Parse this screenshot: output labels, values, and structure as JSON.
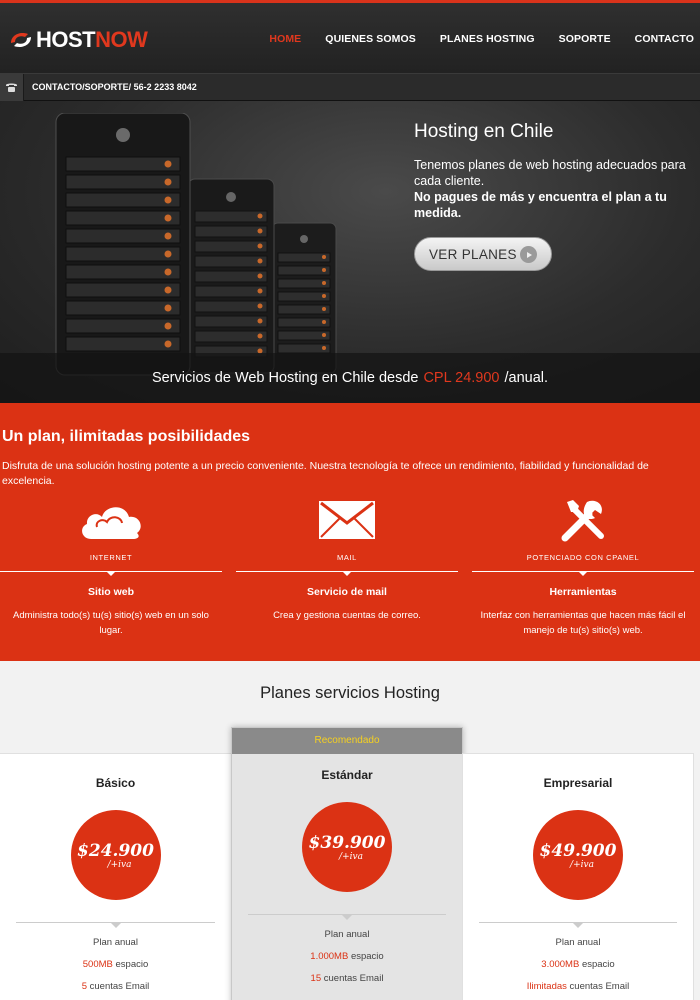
{
  "brand": {
    "host": "HOST",
    "now": "NOW"
  },
  "nav": {
    "items": [
      {
        "label": "HOME",
        "active": true
      },
      {
        "label": "QUIENES SOMOS",
        "active": false
      },
      {
        "label": "PLANES HOSTING",
        "active": false
      },
      {
        "label": "SOPORTE",
        "active": false
      },
      {
        "label": "CONTACTO",
        "active": false
      }
    ]
  },
  "contact_bar": {
    "text": "CONTACTO/SOPORTE/ 56-2 2233 8042",
    "icon": "phone-icon"
  },
  "hero": {
    "title": "Hosting en Chile",
    "desc": "Tenemos planes de web hosting adecuados para cada cliente.",
    "desc_bold": "No pagues de más y encuentra el plan a tu medida.",
    "button": "VER PLANES",
    "band_before": "Servicios de Web Hosting en Chile desde",
    "band_price": "CPL 24.900",
    "band_after": "/anual."
  },
  "features_section": {
    "title": "Un plan, ilimitadas posibilidades",
    "desc": "Disfruta de una solución hosting potente a un precio conveniente. Nuestra tecnología te ofrece un rendimiento, fiabilidad y funcionalidad de excelencia.",
    "items": [
      {
        "caption": "INTERNET",
        "title": "Sitio web",
        "desc": "Administra todo(s) tu(s) sitio(s) web en un solo lugar.",
        "icon": "cloud-icon"
      },
      {
        "caption": "MAIL",
        "title": "Servicio de mail",
        "desc": "Crea y gestiona cuentas de correo.",
        "icon": "envelope-icon"
      },
      {
        "caption": "POTENCIADO CON CPANEL",
        "title": "Herramientas",
        "desc": "Interfaz con herramientas que hacen más fácil el manejo de tu(s) sitio(s) web.",
        "icon": "tools-icon"
      }
    ]
  },
  "plans": {
    "title": "Planes servicios Hosting",
    "recommended_label": "Recomendado",
    "items": [
      {
        "name": "Básico",
        "price": "$24.900",
        "iva": "/+iva",
        "f1": "Plan anual",
        "f2_hl": "500MB",
        "f2": " espacio",
        "f3_hl": "5",
        "f3": " cuentas Email"
      },
      {
        "name": "Estándar",
        "price": "$39.900",
        "iva": "/+iva",
        "f1": "Plan anual",
        "f2_hl": "1.000MB",
        "f2": " espacio",
        "f3_hl": "15",
        "f3": " cuentas Email"
      },
      {
        "name": "Empresarial",
        "price": "$49.900",
        "iva": "/+iva",
        "f1": "Plan anual",
        "f2_hl": "3.000MB",
        "f2": " espacio",
        "f3_hl": "Ilimitadas",
        "f3": " cuentas Email"
      }
    ]
  },
  "colors": {
    "accent": "#db3214",
    "dark": "#222222",
    "recommended_text": "#f5d020"
  }
}
